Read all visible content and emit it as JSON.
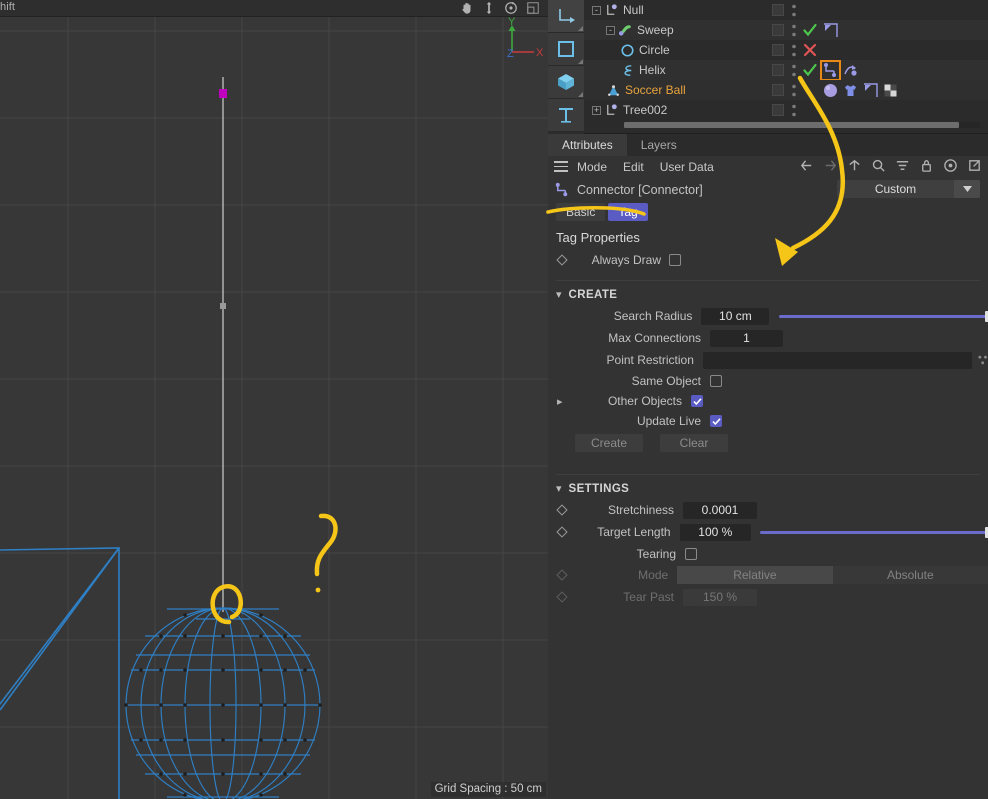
{
  "viewport": {
    "top_text": "hift",
    "grid_spacing": "Grid Spacing : 50 cm",
    "axis": {
      "x": "X",
      "y": "Y",
      "z": "Z"
    },
    "icons": [
      "hand-pan-icon",
      "move-zoom-icon",
      "rotate-icon",
      "maximize-panel-icon"
    ]
  },
  "toolbar": {
    "items": [
      {
        "name": "spline-axis-tool",
        "icon": "axis-arrow-icon"
      },
      {
        "name": "rectangle-tool",
        "icon": "square-icon"
      },
      {
        "name": "cube-tool",
        "icon": "cube-icon"
      },
      {
        "name": "text-tool",
        "icon": "text-t-icon"
      }
    ]
  },
  "object_manager": {
    "rows": [
      {
        "label": "Null",
        "icon": "null-object-icon",
        "depth": 0,
        "expander": "-",
        "mark": "",
        "tags": [],
        "highlight": false
      },
      {
        "label": "Sweep",
        "icon": "sweep-icon",
        "depth": 1,
        "expander": "-",
        "mark": "check",
        "tags": [
          "phong-tag"
        ],
        "highlight": false
      },
      {
        "label": "Circle",
        "icon": "circle-spline-icon",
        "depth": 2,
        "expander": "",
        "mark": "cross",
        "tags": [],
        "highlight": false
      },
      {
        "label": "Helix",
        "icon": "helix-spline-icon",
        "depth": 2,
        "expander": "",
        "mark": "check",
        "tags": [
          "connector-tag",
          "dynamics-tag"
        ],
        "highlight": false
      },
      {
        "label": "Soccer Ball",
        "icon": "soccer-ball-icon",
        "depth": 1,
        "expander": "",
        "mark": "",
        "tags": [
          "material-tag",
          "cloth-tag",
          "phong-tag",
          "texture-tag"
        ],
        "highlight": true
      },
      {
        "label": "Tree002",
        "icon": "null-object-icon",
        "depth": 0,
        "expander": "+",
        "mark": "",
        "tags": [],
        "highlight": false
      }
    ]
  },
  "attributes": {
    "tabs": [
      {
        "label": "Attributes",
        "active": true
      },
      {
        "label": "Layers",
        "active": false
      }
    ],
    "menu": [
      "Mode",
      "Edit",
      "User Data"
    ],
    "menu_icons": [
      "back-arrow-icon",
      "forward-arrow-icon",
      "up-arrow-icon",
      "search-icon",
      "filter-icon",
      "lock-icon",
      "record-target-icon",
      "open-external-icon"
    ],
    "object_title": "Connector [Connector]",
    "preset": "Custom",
    "subtabs": [
      {
        "label": "Basic",
        "active": false
      },
      {
        "label": "Tag",
        "active": true
      }
    ],
    "properties_title": "Tag Properties",
    "always_draw": {
      "label": "Always Draw",
      "checked": false
    },
    "create_section": {
      "title": "CREATE",
      "search_radius": {
        "label": "Search Radius",
        "value": "10 cm",
        "slider": 100
      },
      "max_connections": {
        "label": "Max Connections",
        "value": "1"
      },
      "point_restriction": {
        "label": "Point Restriction",
        "value": ""
      },
      "same_object": {
        "label": "Same Object",
        "checked": false
      },
      "other_objects": {
        "label": "Other Objects",
        "checked": true
      },
      "update_live": {
        "label": "Update Live",
        "checked": true
      },
      "create_button": "Create",
      "clear_button": "Clear"
    },
    "settings_section": {
      "title": "SETTINGS",
      "stretchiness": {
        "label": "Stretchiness",
        "value": "0.0001"
      },
      "target_length": {
        "label": "Target Length",
        "value": "100 %",
        "slider": 100
      },
      "tearing": {
        "label": "Tearing",
        "checked": false
      },
      "mode": {
        "label": "Mode",
        "relative": "Relative",
        "absolute": "Absolute",
        "selected": "Relative"
      },
      "tear_past": {
        "label": "Tear Past",
        "value": "150 %"
      }
    }
  },
  "colors": {
    "accent_purple": "#5b5bc4",
    "annotation_yellow": "#f5c518",
    "highlight_orange": "#e8a33d",
    "wireframe_blue": "#2f7fc4",
    "check_green": "#4cc94c",
    "cross_red": "#e05555"
  }
}
